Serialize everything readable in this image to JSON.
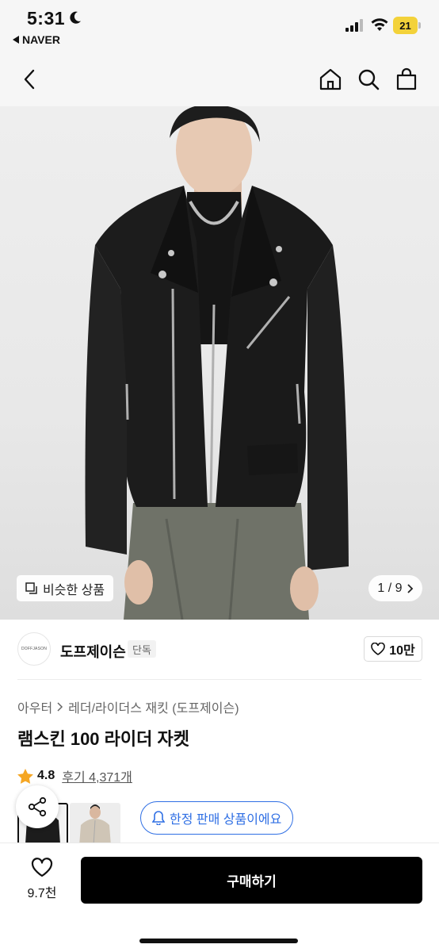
{
  "status_bar": {
    "time": "5:31",
    "back_app": "NAVER",
    "battery": "21"
  },
  "header": {
    "back_icon": "chevron-left-icon",
    "home_icon": "home-icon",
    "search_icon": "search-icon",
    "cart_icon": "shopping-bag-icon"
  },
  "gallery": {
    "similar_label": "비슷한 상품",
    "page_indicator": "1 / 9"
  },
  "brand": {
    "logo_text": "DOFFJASON",
    "name": "도프제이슨",
    "tag": "단독",
    "likes": "10만"
  },
  "product": {
    "breadcrumb": [
      "아우터",
      "레더/라이더스 재킷 (도프제이슨)"
    ],
    "title": "램스킨 100 라이더 자켓",
    "rating": "4.8",
    "review_label": "후기 4,371개",
    "limited_label": "한정 판매 상품이에요"
  },
  "bottom_bar": {
    "wish_count": "9.7천",
    "buy_label": "구매하기"
  },
  "colors": {
    "accent_blue": "#2f6fe4",
    "star": "#f5a623",
    "battery": "#f3d23a",
    "buy_button": "#000000"
  }
}
